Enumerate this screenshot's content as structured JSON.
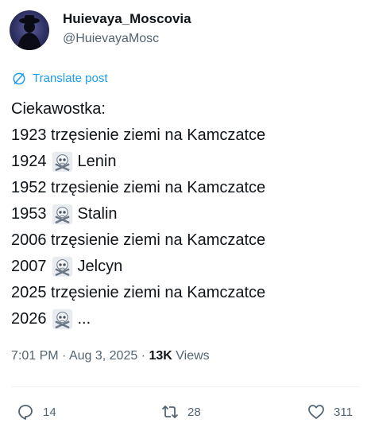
{
  "author": {
    "display_name": "Huievaya_Moscovia",
    "handle": "@HuievayaMosc"
  },
  "translate_label": "Translate post",
  "post_lines": [
    {
      "text": "Ciekawostka:",
      "skull": false,
      "suffix": ""
    },
    {
      "text": "1923 trzęsienie ziemi na Kamczatce",
      "skull": false,
      "suffix": ""
    },
    {
      "text": "1924",
      "skull": true,
      "suffix": "Lenin"
    },
    {
      "text": "1952 trzęsienie ziemi na Kamczatce",
      "skull": false,
      "suffix": ""
    },
    {
      "text": "1953",
      "skull": true,
      "suffix": "Stalin"
    },
    {
      "text": "2006 trzęsienie ziemi na Kamczatce",
      "skull": false,
      "suffix": ""
    },
    {
      "text": "2007",
      "skull": true,
      "suffix": "Jelcyn"
    },
    {
      "text": "2025 trzęsienie ziemi na Kamczatce",
      "skull": false,
      "suffix": ""
    },
    {
      "text": "2026",
      "skull": true,
      "suffix": "..."
    }
  ],
  "meta": {
    "time": "7:01 PM",
    "date": "Aug 3, 2025",
    "views_count": "13K",
    "views_label": "Views"
  },
  "actions": {
    "replies": "14",
    "reposts": "28",
    "likes": "311"
  },
  "colors": {
    "link": "#1d9bf0",
    "secondary_text": "#536471",
    "primary_text": "#0f1419"
  }
}
